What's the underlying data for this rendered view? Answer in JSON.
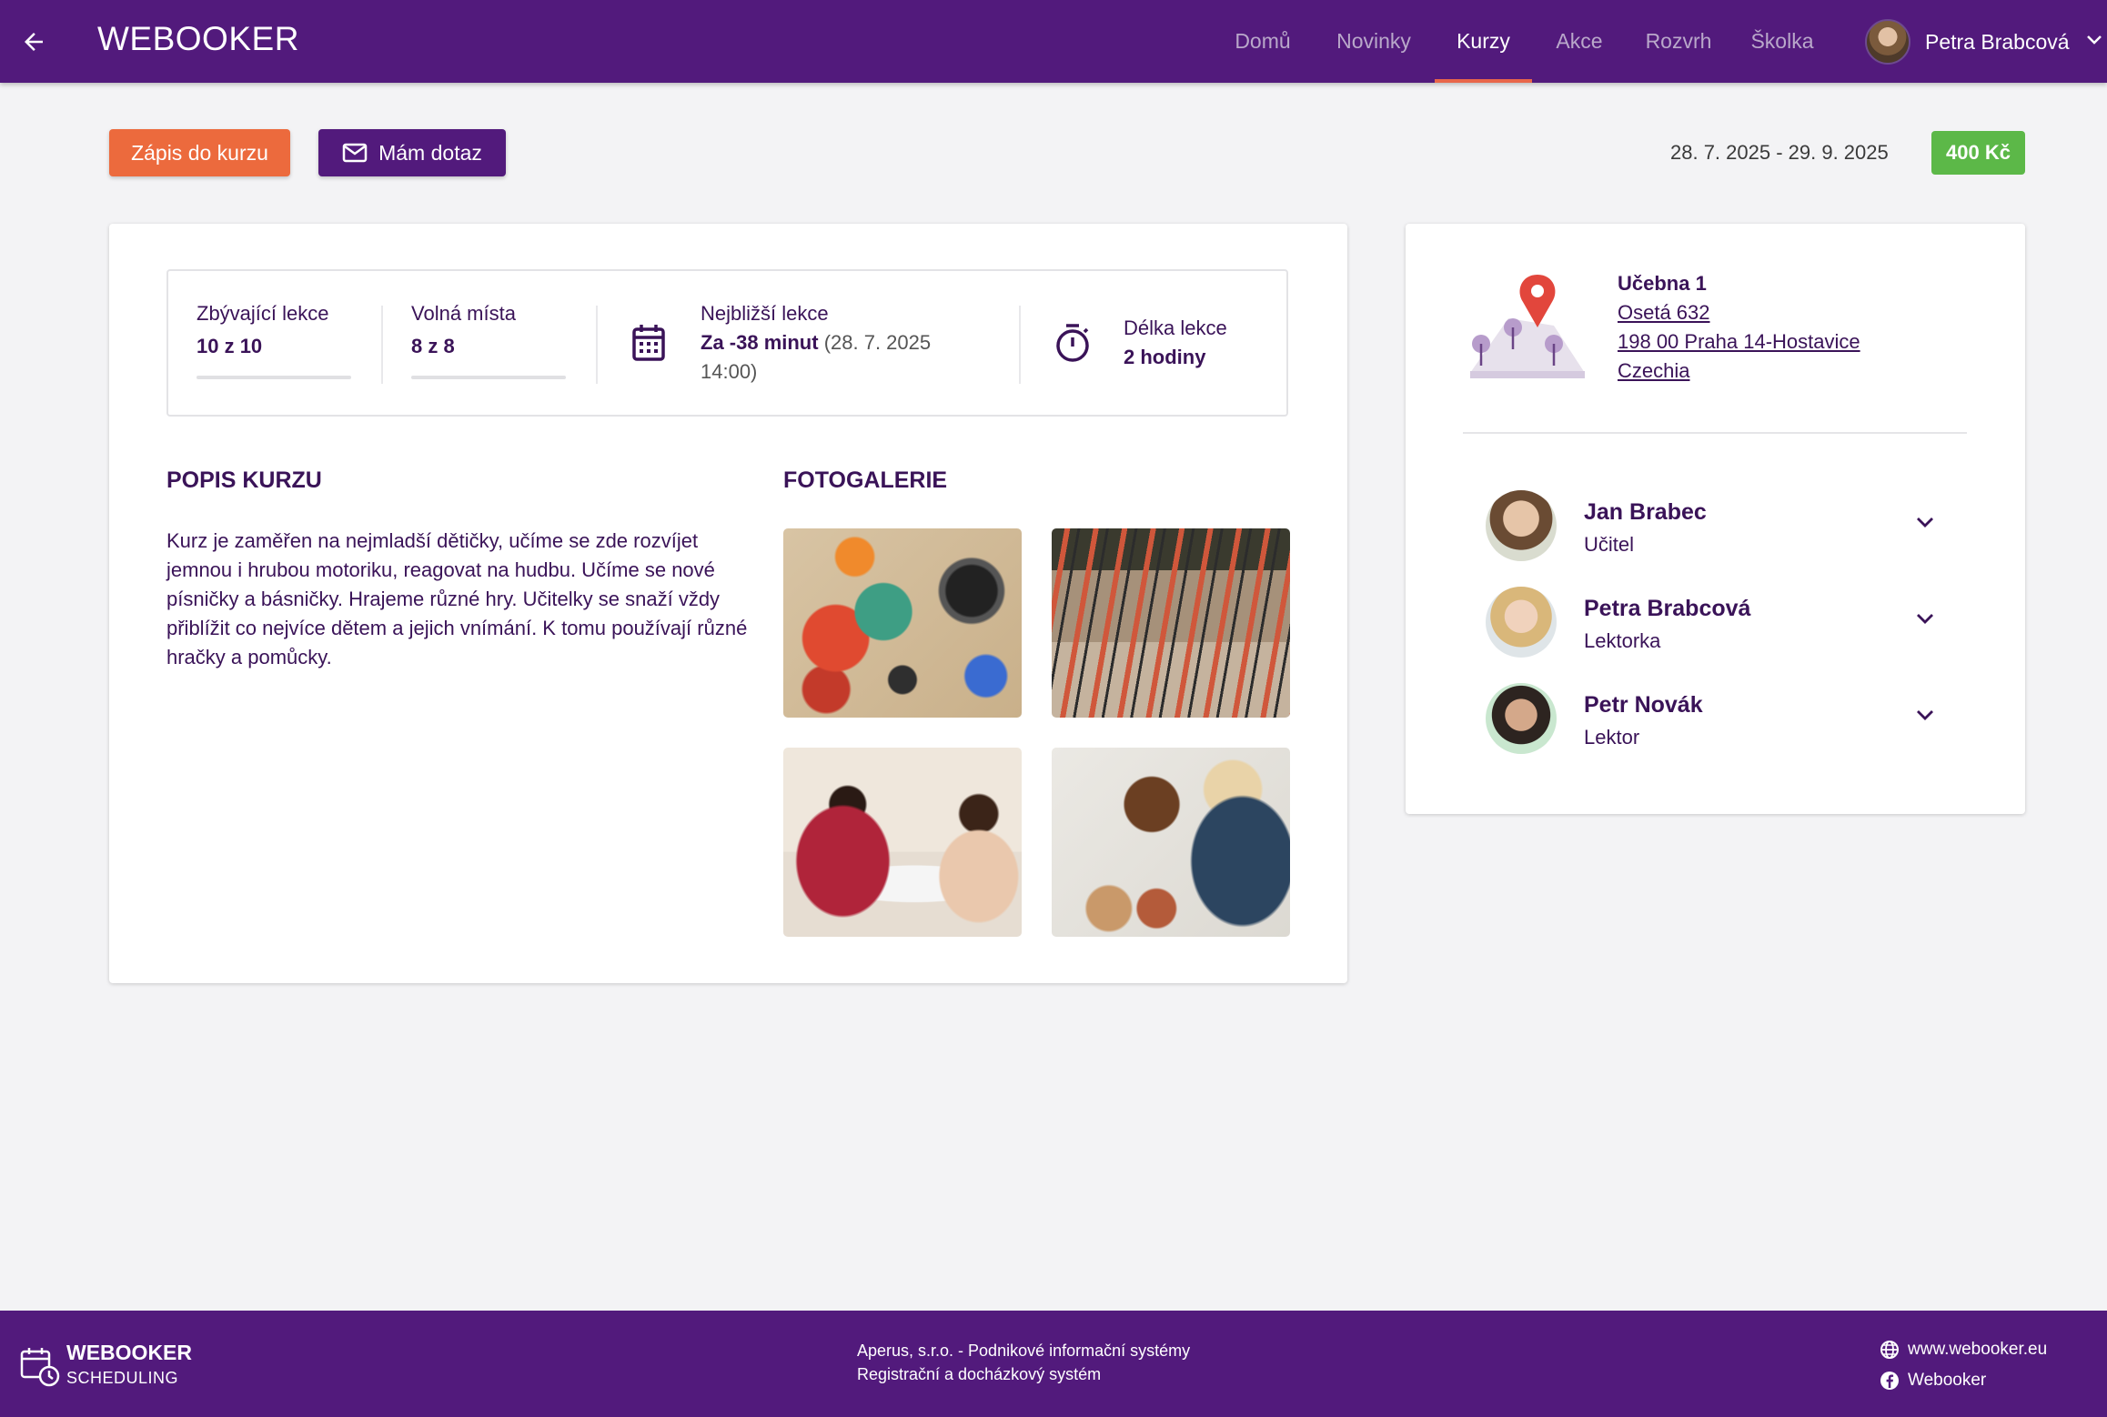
{
  "header": {
    "brand": "WEBOOKER",
    "nav": [
      "Domů",
      "Novinky",
      "Kurzy",
      "Akce",
      "Rozvrh",
      "Školka"
    ],
    "active_nav": "Kurzy",
    "user_name": "Petra Brabcová"
  },
  "actions": {
    "enroll_label": "Zápis do kurzu",
    "question_label": "Mám dotaz",
    "date_range": "28. 7. 2025 - 29. 9. 2025",
    "price": "400 Kč"
  },
  "stats": {
    "remaining_label": "Zbývající lekce",
    "remaining_value": "10 z 10",
    "free_label": "Volná místa",
    "free_value": "8 z 8",
    "next_label": "Nejbližší lekce",
    "next_value_bold": "Za -38 minut",
    "next_value_rest": " (28. 7. 2025",
    "next_value_line2": "14:00)",
    "duration_label": "Délka lekce",
    "duration_value": "2 hodiny"
  },
  "description": {
    "title": "POPIS KURZU",
    "text": "Kurz je zaměřen na nejmladší dětičky, učíme se zde rozvíjet jemnou i hrubou motoriku, reagovat na hudbu. Učíme se nové písničky a básničky. Hrajeme různé hry. Učitelky se snaží vždy přiblížit co nejvíce dětem a jejich vnímání. K tomu používají různé hračky a pomůcky."
  },
  "gallery": {
    "title": "FOTOGALERIE",
    "count": 4
  },
  "location": {
    "room": "Učebna 1",
    "street": "Osetá 632",
    "city": "198 00 Praha 14-Hostavice",
    "country": "Czechia"
  },
  "staff": [
    {
      "name": "Jan Brabec",
      "role": "Učitel"
    },
    {
      "name": "Petra Brabcová",
      "role": "Lektorka"
    },
    {
      "name": "Petr Novák",
      "role": "Lektor"
    }
  ],
  "footer": {
    "brand": "WEBOOKER",
    "brand_sub": "SCHEDULING",
    "company_line1": "Aperus, s.r.o. - Podnikové informační systémy",
    "company_line2": "Registrační a docházkový systém",
    "web": "www.webooker.eu",
    "facebook": "Webooker"
  },
  "colors": {
    "primary": "#521a7c",
    "accent": "#ec6a3d",
    "price_badge": "#5cb848"
  }
}
